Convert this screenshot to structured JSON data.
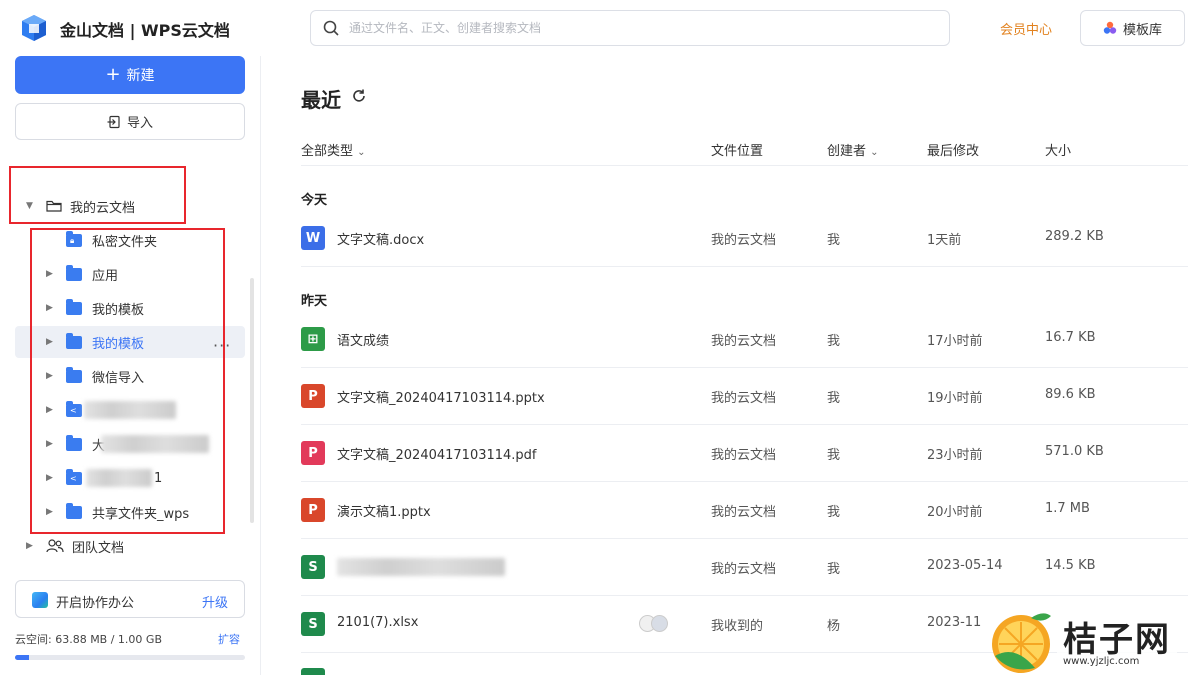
{
  "app": {
    "title": "金山文档 | WPS云文档"
  },
  "search": {
    "placeholder": "通过文件名、正文、创建者搜索文档"
  },
  "topbar": {
    "vip_label": "会员中心",
    "template_label": "模板库"
  },
  "sidebar": {
    "new_label": "新建",
    "import_label": "导入",
    "root_label": "我的云文档",
    "items": [
      {
        "label": "私密文件夹",
        "icon": "lock-folder-icon"
      },
      {
        "label": "应用",
        "icon": "folder-icon"
      },
      {
        "label": "我的模板",
        "icon": "folder-icon"
      },
      {
        "label": "我的模板",
        "icon": "folder-icon",
        "selected": true
      },
      {
        "label": "微信导入",
        "icon": "folder-icon"
      },
      {
        "label": "",
        "icon": "shared-folder-icon",
        "redacted": true
      },
      {
        "label": "大",
        "icon": "folder-icon",
        "redacted": true
      },
      {
        "label": "1",
        "icon": "shared-folder-icon",
        "redacted": true
      },
      {
        "label": "共享文件夹_wps",
        "icon": "folder-icon"
      }
    ],
    "team_label": "团队文档",
    "collab_label": "开启协作办公",
    "upgrade_label": "升级",
    "storage_label": "云空间: 63.88 MB / 1.00 GB",
    "storage_used_fraction": 0.062,
    "expand_label": "扩容"
  },
  "main": {
    "title": "最近",
    "columns": {
      "type": "全部类型",
      "location": "文件位置",
      "creator": "创建者",
      "modified": "最后修改",
      "size": "大小"
    },
    "groups": [
      {
        "label": "今天",
        "files": [
          {
            "name": "文字文稿.docx",
            "type": "word",
            "icon_letter": "W",
            "location": "我的云文档",
            "creator": "我",
            "modified": "1天前",
            "size": "289.2 KB"
          }
        ]
      },
      {
        "label": "昨天",
        "files": [
          {
            "name": "语文成绩",
            "type": "sheet-online",
            "icon_letter": "⊞",
            "location": "我的云文档",
            "creator": "我",
            "modified": "17小时前",
            "size": "16.7 KB"
          },
          {
            "name": "文字文稿_20240417103114.pptx",
            "type": "ppt",
            "icon_letter": "P",
            "location": "我的云文档",
            "creator": "我",
            "modified": "19小时前",
            "size": "89.6 KB"
          },
          {
            "name": "文字文稿_20240417103114.pdf",
            "type": "pdf",
            "icon_letter": "P",
            "location": "我的云文档",
            "creator": "我",
            "modified": "23小时前",
            "size": "571.0 KB"
          },
          {
            "name": "演示文稿1.pptx",
            "type": "ppt",
            "icon_letter": "P",
            "location": "我的云文档",
            "creator": "我",
            "modified": "20小时前",
            "size": "1.7 MB"
          },
          {
            "name": "",
            "type": "excel",
            "icon_letter": "S",
            "location": "我的云文档",
            "creator": "我",
            "modified": "2023-05-14",
            "size": "14.5 KB",
            "redacted": true
          },
          {
            "name": "2101(7).xlsx",
            "type": "excel",
            "icon_letter": "S",
            "location": "我收到的",
            "creator": "杨",
            "modified": "2023-11",
            "size": ""
          }
        ]
      }
    ]
  },
  "colors": {
    "accent": "#3c75f5",
    "vip": "#e2821f",
    "word": "#3b6ee8",
    "excel": "#1f8a4c",
    "sheet_online": "#2d9b48",
    "ppt": "#d9472b",
    "pdf": "#e23a5a",
    "highlight": "#e8262d"
  },
  "watermark": {
    "text": "桔子网",
    "url": "www.yjzljc.com"
  }
}
